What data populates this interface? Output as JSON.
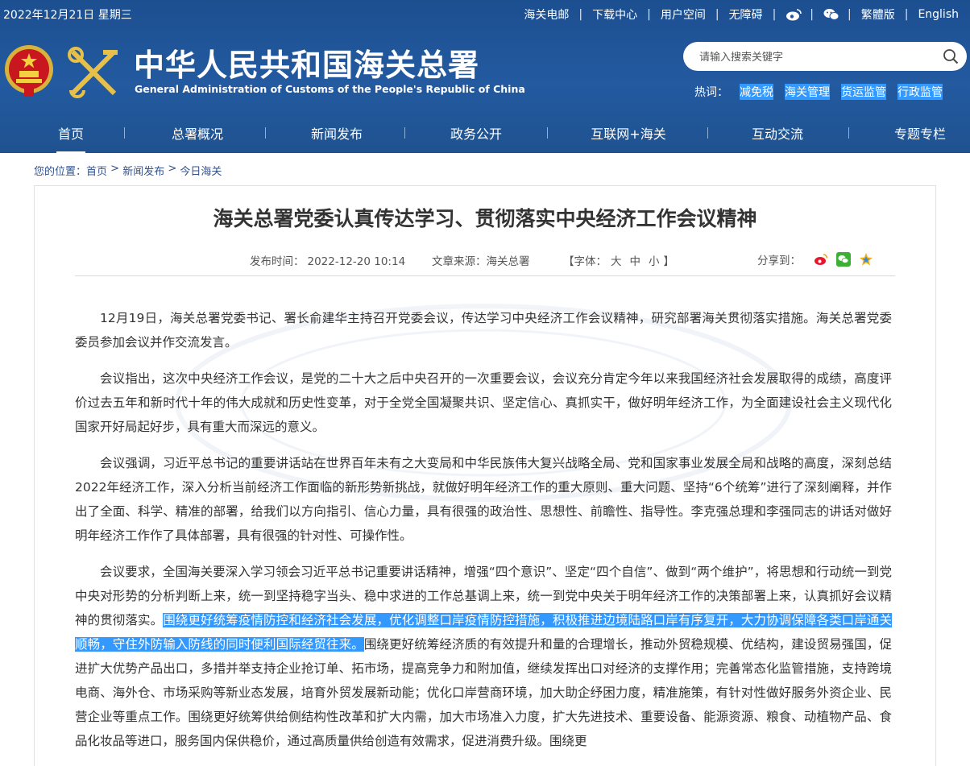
{
  "topbar": {
    "date": "2022年12月21日 星期三",
    "links": [
      "海关电邮",
      "下载中心",
      "用户空间",
      "无障碍"
    ],
    "lang_trad": "繁體版",
    "lang_en": "English"
  },
  "brand": {
    "title_cn": "中华人民共和国海关总署",
    "title_en": "General Administration of Customs of the People's Republic of China"
  },
  "search": {
    "placeholder": "请输入搜索关键字"
  },
  "hot": {
    "label": "热词：",
    "items": [
      "减免税",
      "海关管理",
      "货运监管",
      "行政监管"
    ]
  },
  "nav": [
    "首页",
    "总署概况",
    "新闻发布",
    "政务公开",
    "互联网+海关",
    "互动交流",
    "专题专栏"
  ],
  "breadcrumb": {
    "label": "您的位置：",
    "items": [
      "首页",
      "新闻发布",
      "今日海关"
    ],
    "sep": " > "
  },
  "article": {
    "title": "海关总署党委认真传达学习、贯彻落实中央经济工作会议精神",
    "publish_label": "发布时间：",
    "publish_time": "2022-12-20 10:14",
    "source_label": "文章来源：",
    "source": "海关总署",
    "font_label": "【字体：",
    "font_large": "大",
    "font_mid": "中",
    "font_small": "小",
    "font_close": "】",
    "share_label": "分享到：",
    "p1": "12月19日，海关总署党委书记、署长俞建华主持召开党委会议，传达学习中央经济工作会议精神，研究部署海关贯彻落实措施。海关总署党委委员参加会议并作交流发言。",
    "p2": "会议指出，这次中央经济工作会议，是党的二十大之后中央召开的一次重要会议，会议充分肯定今年以来我国经济社会发展取得的成绩，高度评价过去五年和新时代十年的伟大成就和历史性变革，对于全党全国凝聚共识、坚定信心、真抓实干，做好明年经济工作，为全面建设社会主义现代化国家开好局起好步，具有重大而深远的意义。",
    "p3": "会议强调，习近平总书记的重要讲话站在世界百年未有之大变局和中华民族伟大复兴战略全局、党和国家事业发展全局和战略的高度，深刻总结2022年经济工作，深入分析当前经济工作面临的新形势新挑战，就做好明年经济工作的重大原则、重大问题、坚持“6个统筹”进行了深刻阐释，并作出了全面、科学、精准的部署，给我们以方向指引、信心力量，具有很强的政治性、思想性、前瞻性、指导性。李克强总理和李强同志的讲话对做好明年经济工作作了具体部署，具有很强的针对性、可操作性。",
    "p4_a": "会议要求，全国海关要深入学习领会习近平总书记重要讲话精神，增强“四个意识”、坚定“四个自信”、做到“两个维护”，将思想和行动统一到党中央对形势的分析判断上来，统一到坚持稳字当头、稳中求进的工作总基调上来，统一到党中央关于明年经济工作的决策部署上来，认真抓好会议精神的贯彻落实。",
    "p4_hl": "围绕更好统筹疫情防控和经济社会发展，优化调整口岸疫情防控措施，积极推进边境陆路口岸有序复开，大力协调保障各类口岸通关顺畅，守住外防输入防线的同时便利国际经贸往来。",
    "p4_b": "围绕更好统筹经济质的有效提升和量的合理增长，推动外贸稳规模、优结构，建设贸易强国，促进扩大优势产品出口，多措并举支持企业抢订单、拓市场，提高竞争力和附加值，继续发挥出口对经济的支撑作用；完善常态化监管措施，支持跨境电商、海外仓、市场采购等新业态发展，培育外贸发展新动能；优化口岸营商环境，加大助企纾困力度，精准施策，有针对性做好服务外资企业、民营企业等重点工作。围绕更好统筹供给侧结构性改革和扩大内需，加大市场准入力度，扩大先进技术、重要设备、能源资源、粮食、动植物产品、食品化妆品等进口，服务国内保供稳价，通过高质量供给创造有效需求，促进消费升级。围绕更"
  },
  "colors": {
    "header_bg": "#235aa0",
    "highlight": "#3399ff",
    "crumb": "#33528a"
  }
}
